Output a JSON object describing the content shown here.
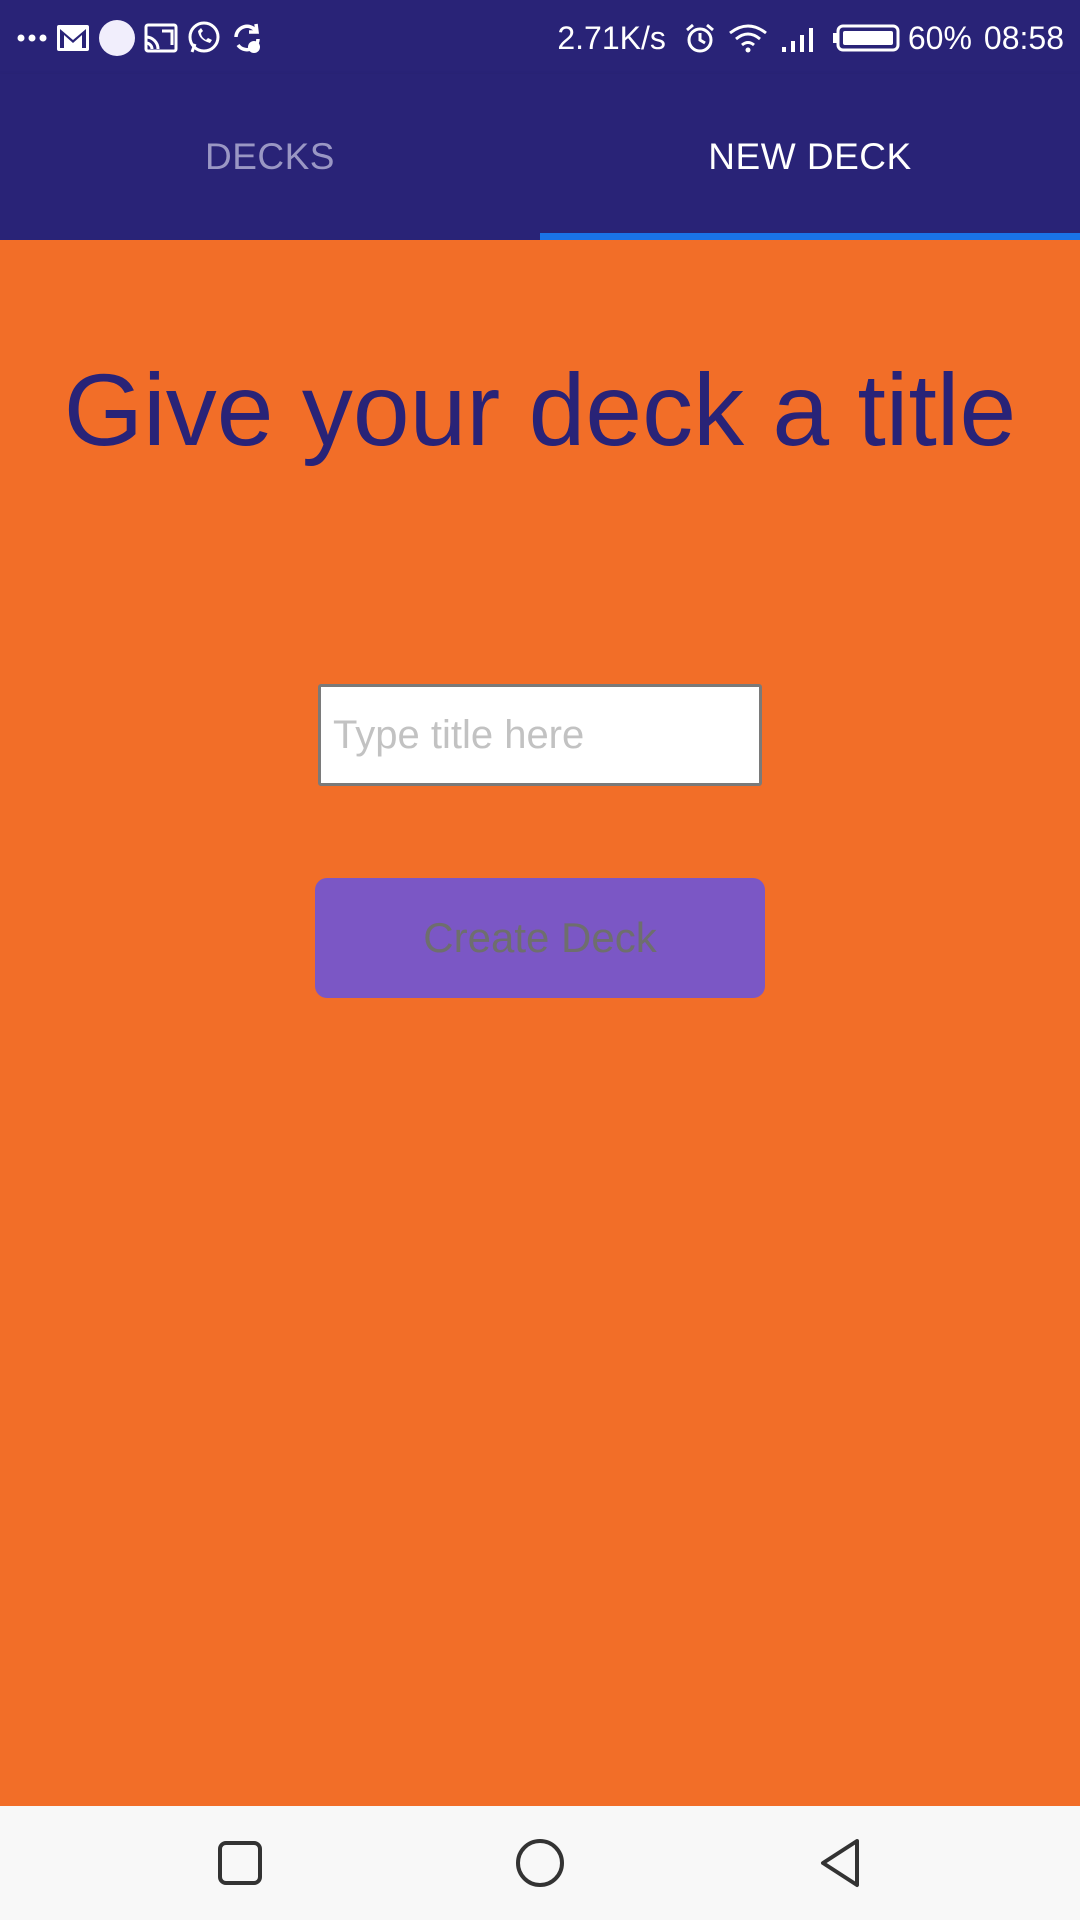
{
  "status_bar": {
    "left_icons": [
      "more-dots-icon",
      "gmail-icon",
      "app-circle-icon",
      "cast-icon",
      "whatsapp-icon",
      "sync-icon"
    ],
    "net_speed": "2.71K/s",
    "right_icons": [
      "alarm-icon",
      "wifi-icon",
      "signal-icon",
      "battery-icon"
    ],
    "battery": "60%",
    "time": "08:58",
    "battery_level": 0.6
  },
  "tabs": [
    {
      "label": "DECKS",
      "active": false
    },
    {
      "label": "NEW DECK",
      "active": true
    }
  ],
  "main": {
    "heading": "Give your deck a title",
    "input": {
      "value": "",
      "placeholder": "Type title here"
    },
    "create_button": "Create Deck"
  },
  "nav_bar": {
    "buttons": [
      "recents-square-icon",
      "home-circle-icon",
      "back-triangle-icon"
    ]
  },
  "colors": {
    "header_bg": "#292377",
    "content_bg": "#F26E28",
    "button_bg": "#7B57C5",
    "tab_indicator": "#1a73e8",
    "heading_text": "#292377"
  }
}
